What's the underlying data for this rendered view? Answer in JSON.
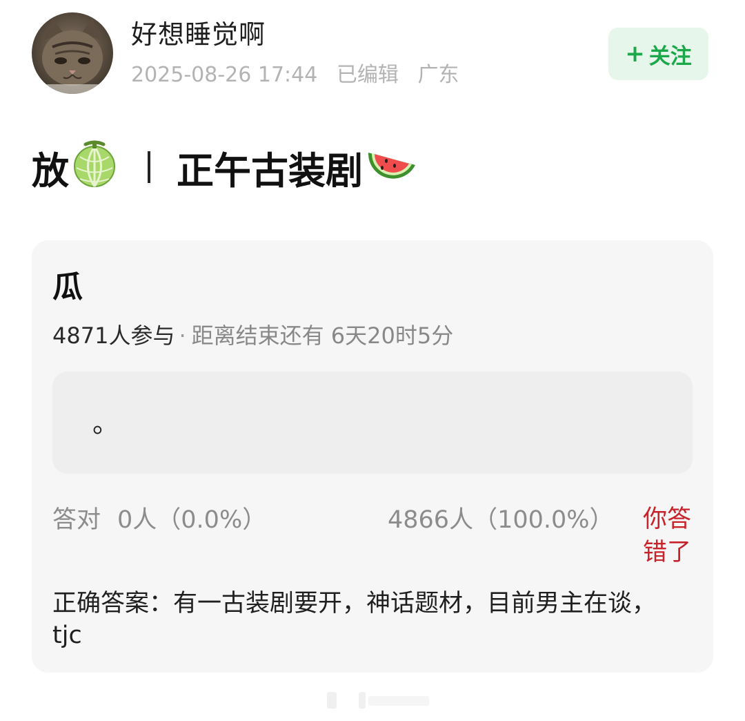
{
  "post": {
    "author": {
      "name": "好想睡觉啊",
      "avatar_icon": "cat-avatar"
    },
    "meta": {
      "datetime": "2025-08-26 17:44",
      "edited": "已编辑",
      "location": "广东"
    },
    "follow_label": "关注",
    "title": {
      "part1": "放",
      "emoji1": "melon-emoji",
      "part2": "正午古装剧",
      "emoji2": "watermelon-emoji"
    }
  },
  "quiz": {
    "title": "瓜",
    "participants": "4871人参与",
    "deadline": "距离结束还有 6天20时5分",
    "option_text": "。",
    "correct_label": "答对",
    "correct_count": "0人（0.0%）",
    "wrong_count": "4866人（100.0%）",
    "wrong_badge": "你答错了",
    "answer": "正确答案：有一古装剧要开，神话题材，目前男主在谈，tjc"
  },
  "colors": {
    "accent_green": "#1aa84a",
    "follow_bg": "#e6f6ea",
    "wrong_red": "#c8232b",
    "card_bg": "#f6f6f6"
  }
}
